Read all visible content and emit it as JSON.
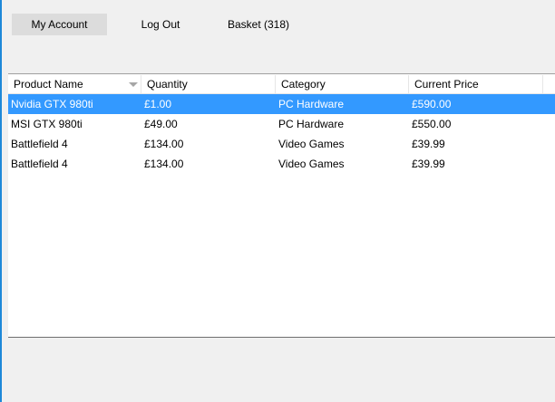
{
  "toolbar": {
    "my_account_label": "My Account",
    "log_out_label": "Log Out",
    "basket_label": "Basket (318)"
  },
  "table": {
    "columns": [
      "Product Name",
      "Quantity",
      "Category",
      "Current Price"
    ],
    "sorted_column_indicator": "chevron-down-icon",
    "selected_row": 0,
    "selection_color": "#3399ff",
    "rows": [
      [
        "Nvidia GTX 980ti",
        "£1.00",
        "PC Hardware",
        "£590.00"
      ],
      [
        "MSI GTX 980ti",
        "£49.00",
        "PC Hardware",
        "£550.00"
      ],
      [
        "Battlefield 4",
        "£134.00",
        "Video Games",
        "£39.99"
      ],
      [
        "Battlefield 4",
        "£134.00",
        "Video Games",
        "£39.99"
      ]
    ]
  }
}
